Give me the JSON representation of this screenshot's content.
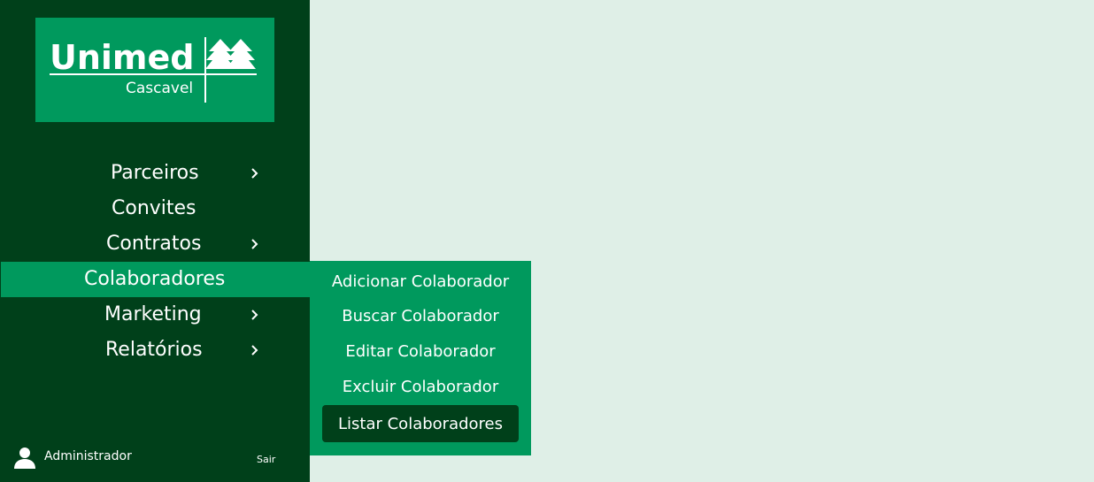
{
  "logo": {
    "brand": "Unimed",
    "city": "Cascavel"
  },
  "menu": {
    "items": [
      {
        "label": "Parceiros",
        "has_submenu": true
      },
      {
        "label": "Convites",
        "has_submenu": false
      },
      {
        "label": "Contratos",
        "has_submenu": true
      },
      {
        "label": "Colaboradores",
        "has_submenu": true,
        "active": true
      },
      {
        "label": "Marketing",
        "has_submenu": true
      },
      {
        "label": "Relatórios",
        "has_submenu": true
      }
    ]
  },
  "submenu": {
    "items": [
      {
        "label": "Adicionar Colaborador"
      },
      {
        "label": "Buscar Colaborador"
      },
      {
        "label": "Editar Colaborador"
      },
      {
        "label": "Excluir Colaborador"
      },
      {
        "label": "Listar Colaboradores",
        "hovered": true
      }
    ]
  },
  "user": {
    "name": "Administrador",
    "logout_label": "Sair",
    "icon": "user-icon"
  },
  "colors": {
    "sidebar": "#00401a",
    "brand_green": "#00995d",
    "content_bg": "#dfefe7"
  }
}
